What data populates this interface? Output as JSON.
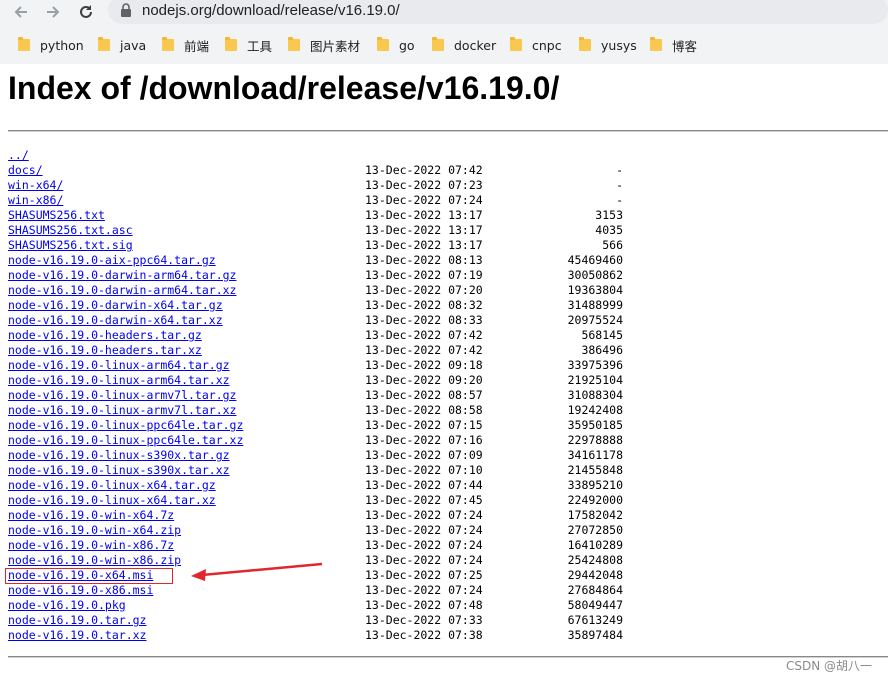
{
  "browser": {
    "url": "nodejs.org/download/release/v16.19.0/",
    "bookmarks": [
      "python",
      "java",
      "前端",
      "工具",
      "图片素材",
      "go",
      "docker",
      "cnpc",
      "yusys",
      "博客"
    ]
  },
  "page": {
    "title": "Index of /download/release/v16.19.0/"
  },
  "listing": [
    {
      "name": "../",
      "date": "",
      "size": ""
    },
    {
      "name": "docs/",
      "date": "13-Dec-2022 07:42",
      "size": "-"
    },
    {
      "name": "win-x64/",
      "date": "13-Dec-2022 07:23",
      "size": "-"
    },
    {
      "name": "win-x86/",
      "date": "13-Dec-2022 07:24",
      "size": "-"
    },
    {
      "name": "SHASUMS256.txt",
      "date": "13-Dec-2022 13:17",
      "size": "3153"
    },
    {
      "name": "SHASUMS256.txt.asc",
      "date": "13-Dec-2022 13:17",
      "size": "4035"
    },
    {
      "name": "SHASUMS256.txt.sig",
      "date": "13-Dec-2022 13:17",
      "size": "566"
    },
    {
      "name": "node-v16.19.0-aix-ppc64.tar.gz",
      "date": "13-Dec-2022 08:13",
      "size": "45469460"
    },
    {
      "name": "node-v16.19.0-darwin-arm64.tar.gz",
      "date": "13-Dec-2022 07:19",
      "size": "30050862"
    },
    {
      "name": "node-v16.19.0-darwin-arm64.tar.xz",
      "date": "13-Dec-2022 07:20",
      "size": "19363804"
    },
    {
      "name": "node-v16.19.0-darwin-x64.tar.gz",
      "date": "13-Dec-2022 08:32",
      "size": "31488999"
    },
    {
      "name": "node-v16.19.0-darwin-x64.tar.xz",
      "date": "13-Dec-2022 08:33",
      "size": "20975524"
    },
    {
      "name": "node-v16.19.0-headers.tar.gz",
      "date": "13-Dec-2022 07:42",
      "size": "568145"
    },
    {
      "name": "node-v16.19.0-headers.tar.xz",
      "date": "13-Dec-2022 07:42",
      "size": "386496"
    },
    {
      "name": "node-v16.19.0-linux-arm64.tar.gz",
      "date": "13-Dec-2022 09:18",
      "size": "33975396"
    },
    {
      "name": "node-v16.19.0-linux-arm64.tar.xz",
      "date": "13-Dec-2022 09:20",
      "size": "21925104"
    },
    {
      "name": "node-v16.19.0-linux-armv7l.tar.gz",
      "date": "13-Dec-2022 08:57",
      "size": "31088304"
    },
    {
      "name": "node-v16.19.0-linux-armv7l.tar.xz",
      "date": "13-Dec-2022 08:58",
      "size": "19242408"
    },
    {
      "name": "node-v16.19.0-linux-ppc64le.tar.gz",
      "date": "13-Dec-2022 07:15",
      "size": "35950185"
    },
    {
      "name": "node-v16.19.0-linux-ppc64le.tar.xz",
      "date": "13-Dec-2022 07:16",
      "size": "22978888"
    },
    {
      "name": "node-v16.19.0-linux-s390x.tar.gz",
      "date": "13-Dec-2022 07:09",
      "size": "34161178"
    },
    {
      "name": "node-v16.19.0-linux-s390x.tar.xz",
      "date": "13-Dec-2022 07:10",
      "size": "21455848"
    },
    {
      "name": "node-v16.19.0-linux-x64.tar.gz",
      "date": "13-Dec-2022 07:44",
      "size": "33895210"
    },
    {
      "name": "node-v16.19.0-linux-x64.tar.xz",
      "date": "13-Dec-2022 07:45",
      "size": "22492000"
    },
    {
      "name": "node-v16.19.0-win-x64.7z",
      "date": "13-Dec-2022 07:24",
      "size": "17582042"
    },
    {
      "name": "node-v16.19.0-win-x64.zip",
      "date": "13-Dec-2022 07:24",
      "size": "27072850"
    },
    {
      "name": "node-v16.19.0-win-x86.7z",
      "date": "13-Dec-2022 07:24",
      "size": "16410289"
    },
    {
      "name": "node-v16.19.0-win-x86.zip",
      "date": "13-Dec-2022 07:24",
      "size": "25424808"
    },
    {
      "name": "node-v16.19.0-x64.msi",
      "date": "13-Dec-2022 07:25",
      "size": "29442048"
    },
    {
      "name": "node-v16.19.0-x86.msi",
      "date": "13-Dec-2022 07:24",
      "size": "27684864"
    },
    {
      "name": "node-v16.19.0.pkg",
      "date": "13-Dec-2022 07:48",
      "size": "58049447"
    },
    {
      "name": "node-v16.19.0.tar.gz",
      "date": "13-Dec-2022 07:33",
      "size": "67613249"
    },
    {
      "name": "node-v16.19.0.tar.xz",
      "date": "13-Dec-2022 07:38",
      "size": "35897484"
    }
  ],
  "annotation": {
    "color": "#e0272e",
    "highlighted_item": "node-v16.19.0-x64.msi"
  },
  "watermark": "CSDN @胡八一",
  "icons": {
    "back": "back-arrow-icon",
    "forward": "forward-arrow-icon",
    "reload": "reload-icon",
    "secure": "lock-icon",
    "bookmark": "folder-icon"
  }
}
